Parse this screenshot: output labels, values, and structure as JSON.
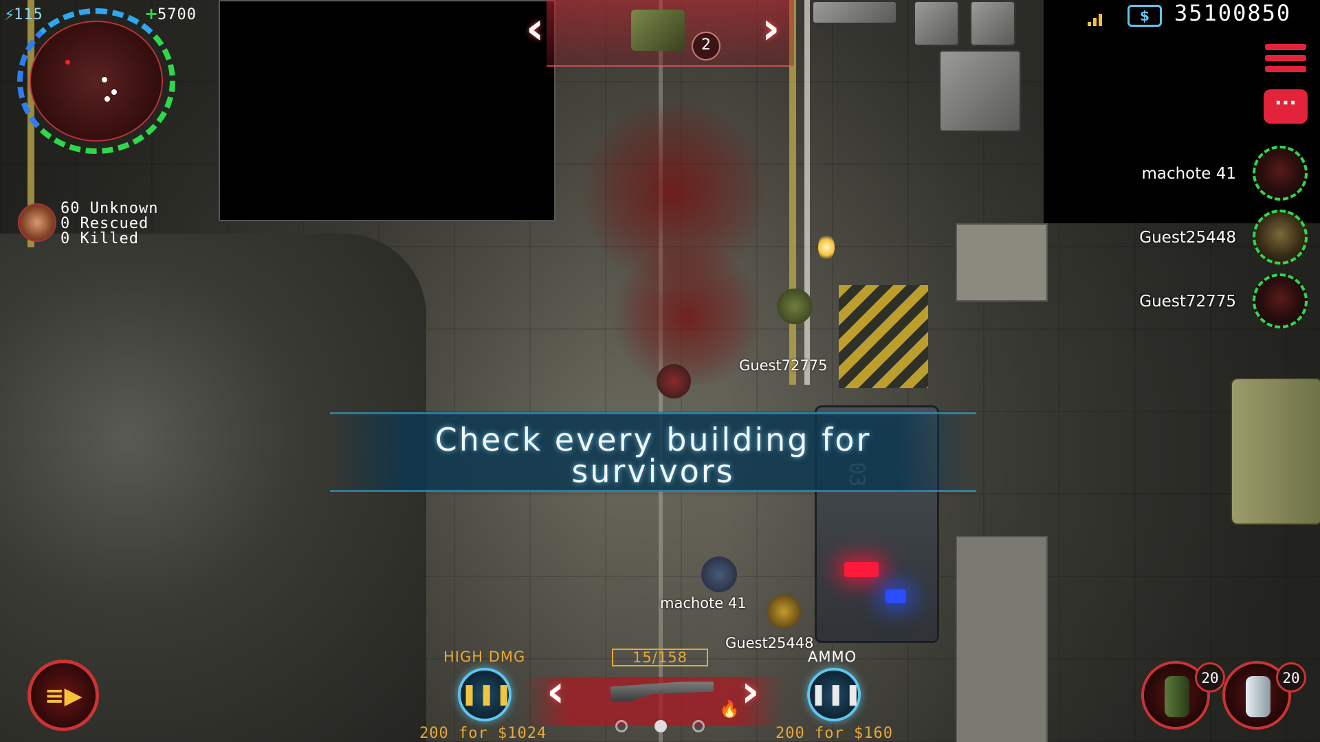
{
  "hud": {
    "energy": "115",
    "health_score": "5700",
    "money": "35100850"
  },
  "survivors": {
    "unknown": "60 Unknown",
    "rescued": "0 Rescued",
    "killed": "0 Killed"
  },
  "top_selector": {
    "count": "2"
  },
  "objective": {
    "line1": "Check every building for",
    "line2": "survivors"
  },
  "team": [
    {
      "name": "machote 41"
    },
    {
      "name": "Guest25448"
    },
    {
      "name": "Guest72775"
    }
  ],
  "world_labels": {
    "p1": "Guest72775",
    "p2": "machote 41",
    "p3": "Guest25448",
    "vehicle": "03"
  },
  "weapons": {
    "ammo_counter": "15/158",
    "left_label": "HIGH DMG",
    "left_price": "200 for $1024",
    "right_label": "AMMO",
    "right_price": "200 for $160",
    "active_page": 1
  },
  "items": [
    {
      "name": "grenade",
      "count": "20"
    },
    {
      "name": "freeze-grenade",
      "count": "20"
    }
  ],
  "colors": {
    "ammo_ring": "#5fc7ef",
    "banner": "#0c3750",
    "team_ring": "#2fd84a",
    "price": "#e7a83a"
  }
}
